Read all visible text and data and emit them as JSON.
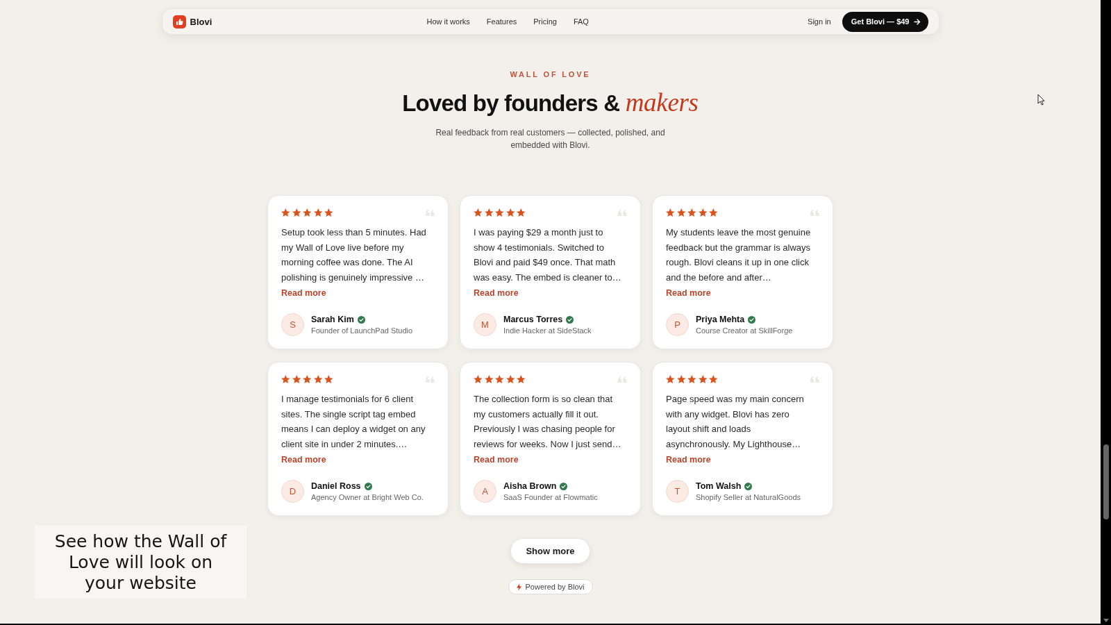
{
  "nav": {
    "brand": "Blovi",
    "links": [
      "How it works",
      "Features",
      "Pricing",
      "FAQ"
    ],
    "sign_in": "Sign in",
    "cta": "Get Blovi — $49"
  },
  "section": {
    "eyebrow": "WALL OF LOVE",
    "title": "Loved by founders & *makers*",
    "subtitle": "Real feedback from real customers — collected, polished, and embedded with Blovi."
  },
  "testimonials": [
    {
      "stars": 5,
      "quote": "Setup took less than 5 minutes. Had my Wall of Love live before my morning coffee was done. The AI polishing is genuinely impressive …",
      "read_more": "Read more",
      "initial": "S",
      "name": "Sarah Kim",
      "verified": true,
      "role": "Founder of LaunchPad Studio"
    },
    {
      "stars": 5,
      "quote": "I was paying $29 a month just to show 4 testimonials. Switched to Blovi and paid $49 once. That math was easy. The embed is cleaner to…",
      "read_more": "Read more",
      "initial": "M",
      "name": "Marcus Torres",
      "verified": true,
      "role": "Indie Hacker at SideStack"
    },
    {
      "stars": 5,
      "quote": "My students leave the most genuine feedback but the grammar is always rough. Blovi cleans it up in one click and the before and after…",
      "read_more": "Read more",
      "initial": "P",
      "name": "Priya Mehta",
      "verified": true,
      "role": "Course Creator at SkillForge"
    },
    {
      "stars": 5,
      "quote": "I manage testimonials for 6 client sites. The single script tag embed means I can deploy a widget on any client site in under 2 minutes.…",
      "read_more": "Read more",
      "initial": "D",
      "name": "Daniel Ross",
      "verified": true,
      "role": "Agency Owner at Bright Web Co."
    },
    {
      "stars": 5,
      "quote": "The collection form is so clean that my customers actually fill it out. Previously I was chasing people for reviews for weeks. Now I just send…",
      "read_more": "Read more",
      "initial": "A",
      "name": "Aisha Brown",
      "verified": true,
      "role": "SaaS Founder at Flowmatic"
    },
    {
      "stars": 5,
      "quote": "Page speed was my main concern with any widget. Blovi has zero layout shift and loads asynchronously. My Lighthouse…",
      "read_more": "Read more",
      "initial": "T",
      "name": "Tom Walsh",
      "verified": true,
      "role": "Shopify Seller at NaturalGoods"
    }
  ],
  "show_more": "Show more",
  "powered_by": "Powered by Blovi",
  "caption": "See how the Wall of Love will look on your website"
}
